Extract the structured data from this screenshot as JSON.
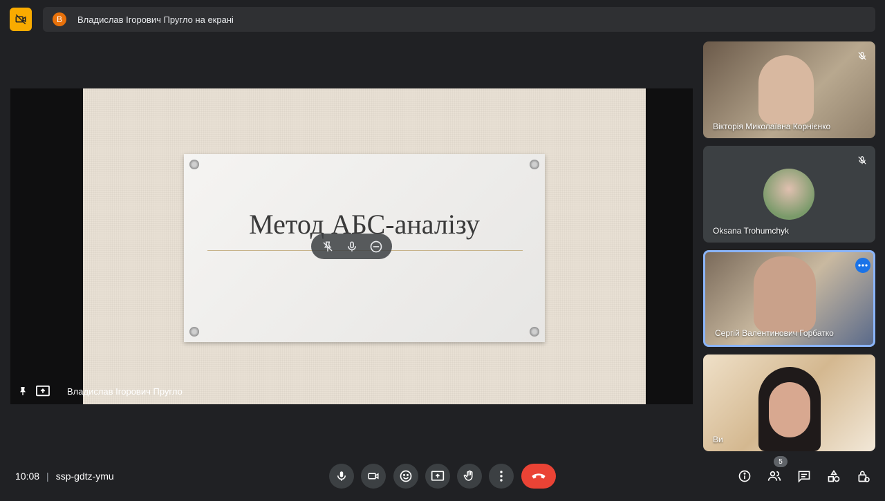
{
  "banner": {
    "avatar_letter": "В",
    "text": "Владислав Ігорович Пругло на екрані"
  },
  "presentation": {
    "slide_title": "Метод АБС-аналізу",
    "presenter_name": "Владислав Ігорович Пругло",
    "overlay_icons": [
      "unpin-icon",
      "mic-icon",
      "remove-icon"
    ]
  },
  "participants": [
    {
      "name": "Вікторія Миколаївна Корнієнко",
      "muted": true
    },
    {
      "name": "Oksana Trohumchyk",
      "muted": true
    },
    {
      "name": "Сергій Валентинович Горбатко",
      "active": true
    },
    {
      "name": "Ви"
    }
  ],
  "bottom_bar": {
    "time": "10:08",
    "meeting_code": "ssp-gdtz-ymu",
    "participant_count": "5",
    "controls": [
      "mic-icon",
      "camera-icon",
      "emoji-icon",
      "present-icon",
      "hand-icon",
      "more-icon",
      "hangup-icon"
    ],
    "right_icons": [
      "info-icon",
      "people-icon",
      "chat-icon",
      "activities-icon",
      "host-controls-icon"
    ]
  },
  "colors": {
    "background": "#202124",
    "tile": "#3c4043",
    "accent": "#8ab4f8",
    "hangup": "#ea4335",
    "camera_off_button": "#f9ab00"
  }
}
